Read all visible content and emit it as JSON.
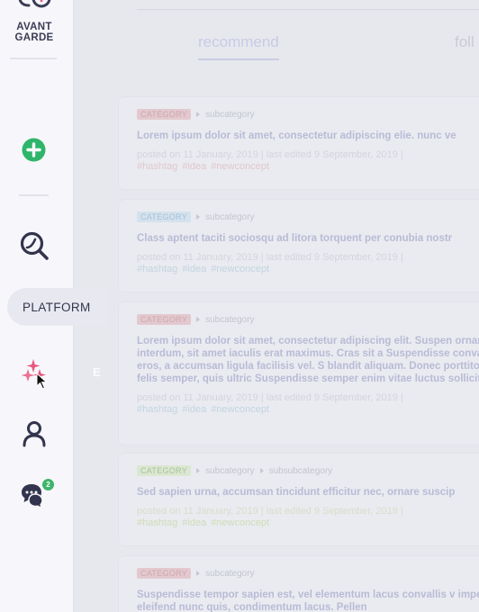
{
  "brand": {
    "line1": "AVANT",
    "line2": "GARDE"
  },
  "tabs": [
    {
      "label": "recommend"
    },
    {
      "label": "foll"
    }
  ],
  "sidebar": {
    "items": [
      {
        "icon": "plus-circle-icon",
        "color": "#2fb56b"
      },
      {
        "icon": "search-icon"
      },
      {
        "icon": "sparkles-icon",
        "color": "#e8577d"
      },
      {
        "icon": "user-icon"
      },
      {
        "icon": "chat-icon"
      }
    ],
    "platform_label": "PLATFORM",
    "flyout_letter": "E",
    "chat_badge": "2"
  },
  "feed": [
    {
      "category": "CATEGORY",
      "category_color": "pink",
      "crumbs": [
        "subcategory"
      ],
      "title": "Lorem ipsum dolor sit amet, consectetur adipiscing elie. nunc ve",
      "posted": "posted on 11 January, 2019 | last edited 9 September, 2019 |",
      "tags": [
        "#hashtag",
        "#idea",
        "#newconcept"
      ],
      "tag_color": "pink"
    },
    {
      "category": "CATEGORY",
      "category_color": "blue",
      "crumbs": [
        "subcategory"
      ],
      "title": "Class aptent taciti sociosqu ad litora torquent per conubia nostr",
      "posted": "posted on 11 January, 2019 | last edited 9 September, 2019 |",
      "tags": [
        "#hashtag",
        "#idea",
        "#newconcept"
      ],
      "tag_color": "blue"
    },
    {
      "category": "CATEGORY",
      "category_color": "pink",
      "crumbs": [
        "subcategory"
      ],
      "title": "Lorem ipsum dolor sit amet, consectetur adipiscing elit. Suspen ornare augue interdum, sit amet iaculis erat maximus. Cras sit a Suspendisse convallis nunc eros, a accumsan ligula facilisis vel. S blandit aliquam. Donec porttitor arcu at felis semper, quis ultric Suspendisse semper enim vitae luctus sollicitudin.",
      "posted": "posted on 11 January, 2019 | last edited 9 September, 2019 |",
      "tags": [
        "#hashtag",
        "#idea",
        "#newconcept"
      ],
      "tag_color": "blue"
    },
    {
      "category": "CATEGORY",
      "category_color": "green",
      "crumbs": [
        "subcategory",
        "subsubcategory"
      ],
      "title": "Sed sapien urna, accumsan tincidunt efficitur nec, ornare suscip",
      "posted": "posted on 11 January, 2019 | last edited 9 September, 2019 |",
      "tags": [
        "#hashtag",
        "#idea",
        "#newconcept"
      ],
      "tag_color": "green"
    },
    {
      "category": "CATEGORY",
      "category_color": "pink",
      "crumbs": [
        "subcategory"
      ],
      "title": "Suspendisse tempor sapien est, vel elementum lacus convallis v imperdiet, eleifend nunc quis, condimentum lacus. Pellen",
      "posted": "",
      "tags": [],
      "tag_color": "blue"
    }
  ]
}
